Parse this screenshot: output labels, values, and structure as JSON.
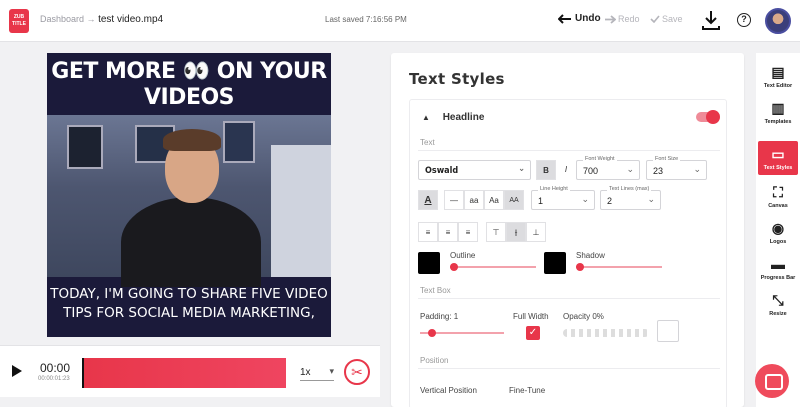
{
  "app": {
    "logo_text": "ZUBTITLE",
    "breadcrumb_root": "Dashboard",
    "breadcrumb_sep": "→",
    "file_name": "test video.mp4",
    "saved_status": "Last saved 7:16:56 PM"
  },
  "toolbar": {
    "undo_label": "Undo",
    "redo_label": "Redo",
    "save_label": "Save",
    "help_label": "?"
  },
  "preview": {
    "headline": "GET MORE 👀 ON YOUR VIDEOS",
    "caption": "TODAY, I'M GOING TO SHARE FIVE VIDEO TIPS FOR SOCIAL MEDIA MARKETING,"
  },
  "timeline": {
    "current_time": "00:00",
    "timecode": "00:00:01:23",
    "speed": "1x",
    "scissors_glyph": "✂"
  },
  "panel": {
    "title": "Text Styles",
    "section_title": "Headline",
    "text_group": "Text",
    "font_family": "Oswald",
    "bold_label": "B",
    "italic_label": "I",
    "font_weight_caption": "Font Weight",
    "font_weight": "700",
    "font_size_caption": "Font Size",
    "font_size": "23",
    "case_buttons": [
      "—",
      "aa",
      "Aa",
      "AA"
    ],
    "line_height_caption": "Line Height",
    "line_height": "1",
    "text_lines_caption": "Text Lines (max)",
    "text_lines": "2",
    "outline_label": "Outline",
    "shadow_label": "Shadow",
    "text_box_group": "Text Box",
    "padding_label": "Padding: 1",
    "full_width_label": "Full Width",
    "opacity_label": "Opacity 0%",
    "position_group": "Position",
    "vertical_position_label": "Vertical Position",
    "fine_tune_label": "Fine-Tune"
  },
  "rail": {
    "items": [
      "Text Editor",
      "Templates",
      "Text Styles",
      "Canvas",
      "Logos",
      "Progress Bar",
      "Resize"
    ]
  },
  "colors": {
    "accent": "#e8364a",
    "outline_color": "#000000",
    "shadow_color": "#000000"
  }
}
